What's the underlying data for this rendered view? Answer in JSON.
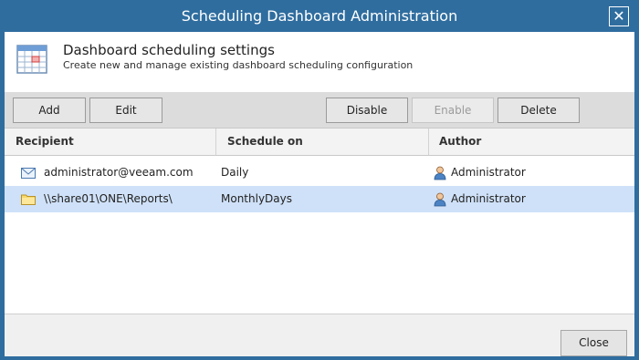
{
  "window": {
    "title": "Scheduling Dashboard Administration",
    "close_glyph": "✕"
  },
  "header": {
    "title": "Dashboard scheduling settings",
    "subtitle": "Create new and manage existing dashboard scheduling configuration"
  },
  "toolbar": {
    "add": "Add",
    "edit": "Edit",
    "disable": "Disable",
    "enable": "Enable",
    "delete": "Delete"
  },
  "table": {
    "columns": [
      "Recipient",
      "Schedule on",
      "Author"
    ],
    "rows": [
      {
        "recipient": "administrator@veeam.com",
        "recipient_icon": "mail-icon",
        "schedule": "Daily",
        "author": "Administrator"
      },
      {
        "recipient": "\\\\share01\\ONE\\Reports\\",
        "recipient_icon": "folder-icon",
        "schedule": "MonthlyDays",
        "author": "Administrator",
        "selected": true
      }
    ]
  },
  "footer": {
    "close": "Close"
  },
  "colors": {
    "title_bar": "#2f6d9f",
    "selection": "#cfe1f8"
  }
}
